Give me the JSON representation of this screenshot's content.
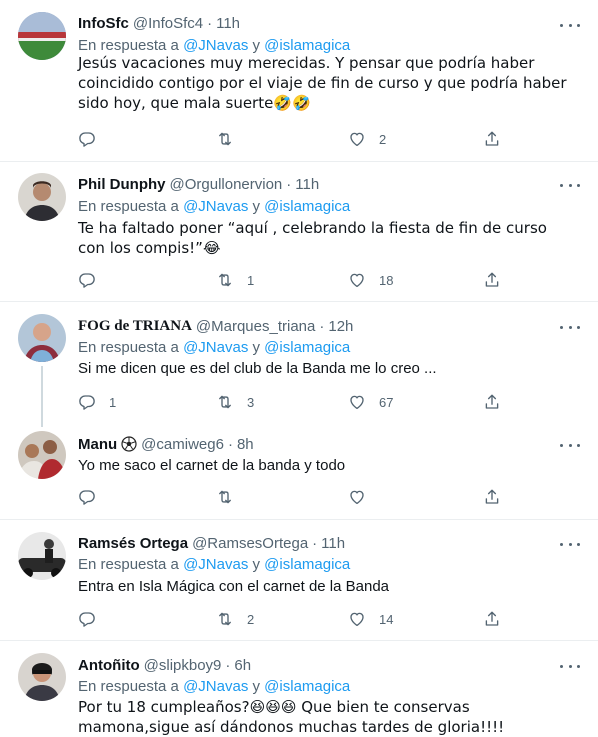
{
  "reply_prefix": "En respuesta a",
  "and_word": "y",
  "mention_1": "@JNavas",
  "mention_2": "@islamagica",
  "tweets": [
    {
      "name": "InfoSfc",
      "handle": "@InfoSfc4",
      "time": "11h",
      "text": "Jesús vacaciones muy merecidas. Y pensar que podría haber coincidido contigo por el viaje de fin de curso y que podría haber sido hoy, que mala suerte🤣🤣",
      "replies": "",
      "retweets": "",
      "likes": "2"
    },
    {
      "name": "Phil Dunphy",
      "handle": "@Orgullonervion",
      "time": "11h",
      "text": "Te ha faltado poner “aquí , celebrando la fiesta de fin de curso con los compis!”😂",
      "replies": "",
      "retweets": "1",
      "likes": "18"
    },
    {
      "name": "FOG de TRIANA",
      "handle": "@Marques_triana",
      "time": "12h",
      "text": "Si me dicen que es del club de la Banda me lo creo ...",
      "replies": "1",
      "retweets": "3",
      "likes": "67"
    },
    {
      "name": "Manu",
      "badge_icon": "soccer-ball-icon",
      "handle": "@camiweg6",
      "time": "8h",
      "text": "Yo me saco el carnet de la banda y todo",
      "replies": "",
      "retweets": "",
      "likes": ""
    },
    {
      "name": "Ramsés Ortega",
      "handle": "@RamsesOrtega",
      "time": "11h",
      "text": "Entra en Isla Mágica con el carnet de la Banda",
      "replies": "",
      "retweets": "2",
      "likes": "14"
    },
    {
      "name": "Antoñito",
      "handle": "@slipkboy9",
      "time": "6h",
      "text": "Por tu 18 cumpleaños?😆😆😆 Que bien te conservas mamona,sigue así dándonos muchas tardes de gloria!!!!",
      "replies": "",
      "retweets": "",
      "likes": ""
    }
  ],
  "colors": {
    "text": "#0f1419",
    "secondary": "#536471",
    "accent": "#1d9bf0",
    "divider": "#ebeef0"
  },
  "icons": [
    "reply-icon",
    "retweet-icon",
    "like-icon",
    "share-icon",
    "more-icon"
  ]
}
